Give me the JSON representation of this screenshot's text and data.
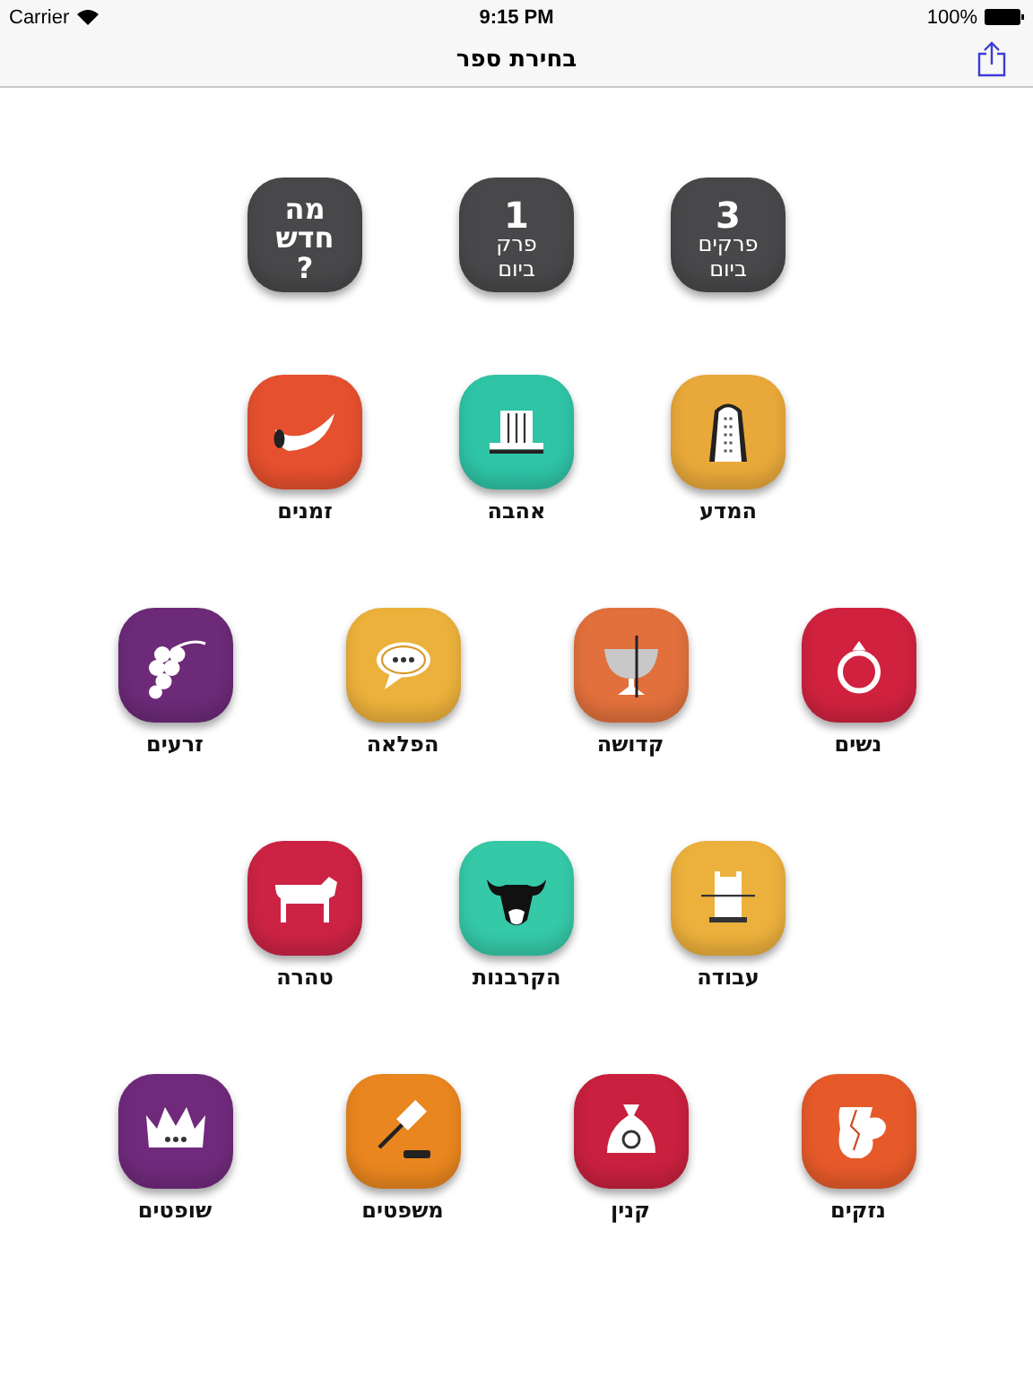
{
  "status_bar": {
    "carrier": "Carrier",
    "time": "9:15 PM",
    "battery": "100%"
  },
  "nav": {
    "title": "בחירת ספר"
  },
  "rows": [
    {
      "items": [
        {
          "kind": "text",
          "color": "#48484a",
          "lines": [
            {
              "kind": "number",
              "text": "3"
            },
            {
              "kind": "word",
              "text": "פרקים"
            },
            {
              "kind": "word",
              "text": "ביום"
            }
          ]
        },
        {
          "kind": "text",
          "color": "#48484a",
          "lines": [
            {
              "kind": "number",
              "text": "1"
            },
            {
              "kind": "word",
              "text": "פרק"
            },
            {
              "kind": "word",
              "text": "ביום"
            }
          ]
        },
        {
          "kind": "text",
          "color": "#48484a",
          "lines": [
            {
              "kind": "heading",
              "text": "מה"
            },
            {
              "kind": "heading",
              "text": "חדש"
            },
            {
              "kind": "heading",
              "text": "?"
            }
          ]
        }
      ]
    },
    {
      "items": [
        {
          "kind": "book",
          "label": "המדע",
          "color": "#e9a93a"
        },
        {
          "kind": "book",
          "label": "אהבה",
          "color": "#2fc4a6"
        },
        {
          "kind": "book",
          "label": "זמנים",
          "color": "#e5502e"
        }
      ]
    },
    {
      "items": [
        {
          "kind": "book",
          "label": "נשים",
          "color": "#d0223f"
        },
        {
          "kind": "book",
          "label": "קדושה",
          "color": "#e2703c"
        },
        {
          "kind": "book",
          "label": "הפלאה",
          "color": "#ecb13b"
        },
        {
          "kind": "book",
          "label": "זרעים",
          "color": "#6c2a78"
        }
      ]
    },
    {
      "items": [
        {
          "kind": "book",
          "label": "עבודה",
          "color": "#ecb03c"
        },
        {
          "kind": "book",
          "label": "הקרבנות",
          "color": "#35c9a8"
        },
        {
          "kind": "book",
          "label": "טהרה",
          "color": "#cc2344"
        }
      ]
    },
    {
      "items": [
        {
          "kind": "book",
          "label": "נזקים",
          "color": "#e65a2a"
        },
        {
          "kind": "book",
          "label": "קנין",
          "color": "#c8203e"
        },
        {
          "kind": "book",
          "label": "משפטים",
          "color": "#e9861f"
        },
        {
          "kind": "book",
          "label": "שופטים",
          "color": "#702a7c"
        }
      ]
    }
  ]
}
